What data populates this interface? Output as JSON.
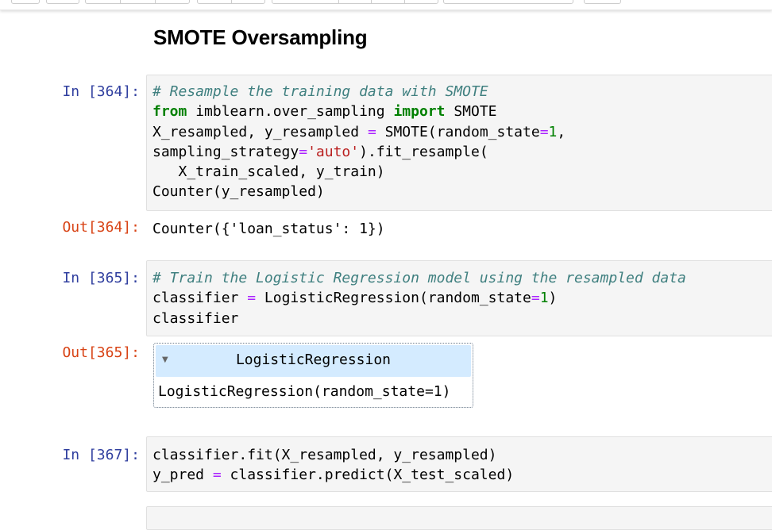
{
  "heading": "SMOTE Oversampling",
  "cells": [
    {
      "in_prompt": "In [364]:",
      "code_lines": [
        "# Resample the training data with SMOTE",
        "from imblearn.over_sampling import SMOTE",
        "X_resampled, y_resampled = SMOTE(random_state=1,",
        "sampling_strategy='auto').fit_resample(",
        "   X_train_scaled, y_train)",
        "Counter(y_resampled)"
      ],
      "out_prompt": "Out[364]:",
      "output": "Counter({'loan_status': 1})"
    },
    {
      "in_prompt": "In [365]:",
      "code_lines": [
        "# Train the Logistic Regression model using the resampled data",
        "classifier = LogisticRegression(random_state=1)",
        "classifier"
      ],
      "out_prompt": "Out[365]:",
      "estimator_title": "LogisticRegression",
      "estimator_params": "LogisticRegression(random_state=1)",
      "estimator_toggle_icon": "triangle-down"
    },
    {
      "in_prompt": "In [367]:",
      "code_lines": [
        "classifier.fit(X_resampled, y_resampled)",
        "y_pred = classifier.predict(X_test_scaled)"
      ]
    }
  ],
  "colors": {
    "in_prompt": "#303f9f",
    "out_prompt": "#d84315",
    "comment": "#408080",
    "keyword": "#008000",
    "operator": "#aa22ff",
    "string": "#ba2121",
    "code_background": "#f5f5f5",
    "estimator_header": "#d4ebff"
  }
}
